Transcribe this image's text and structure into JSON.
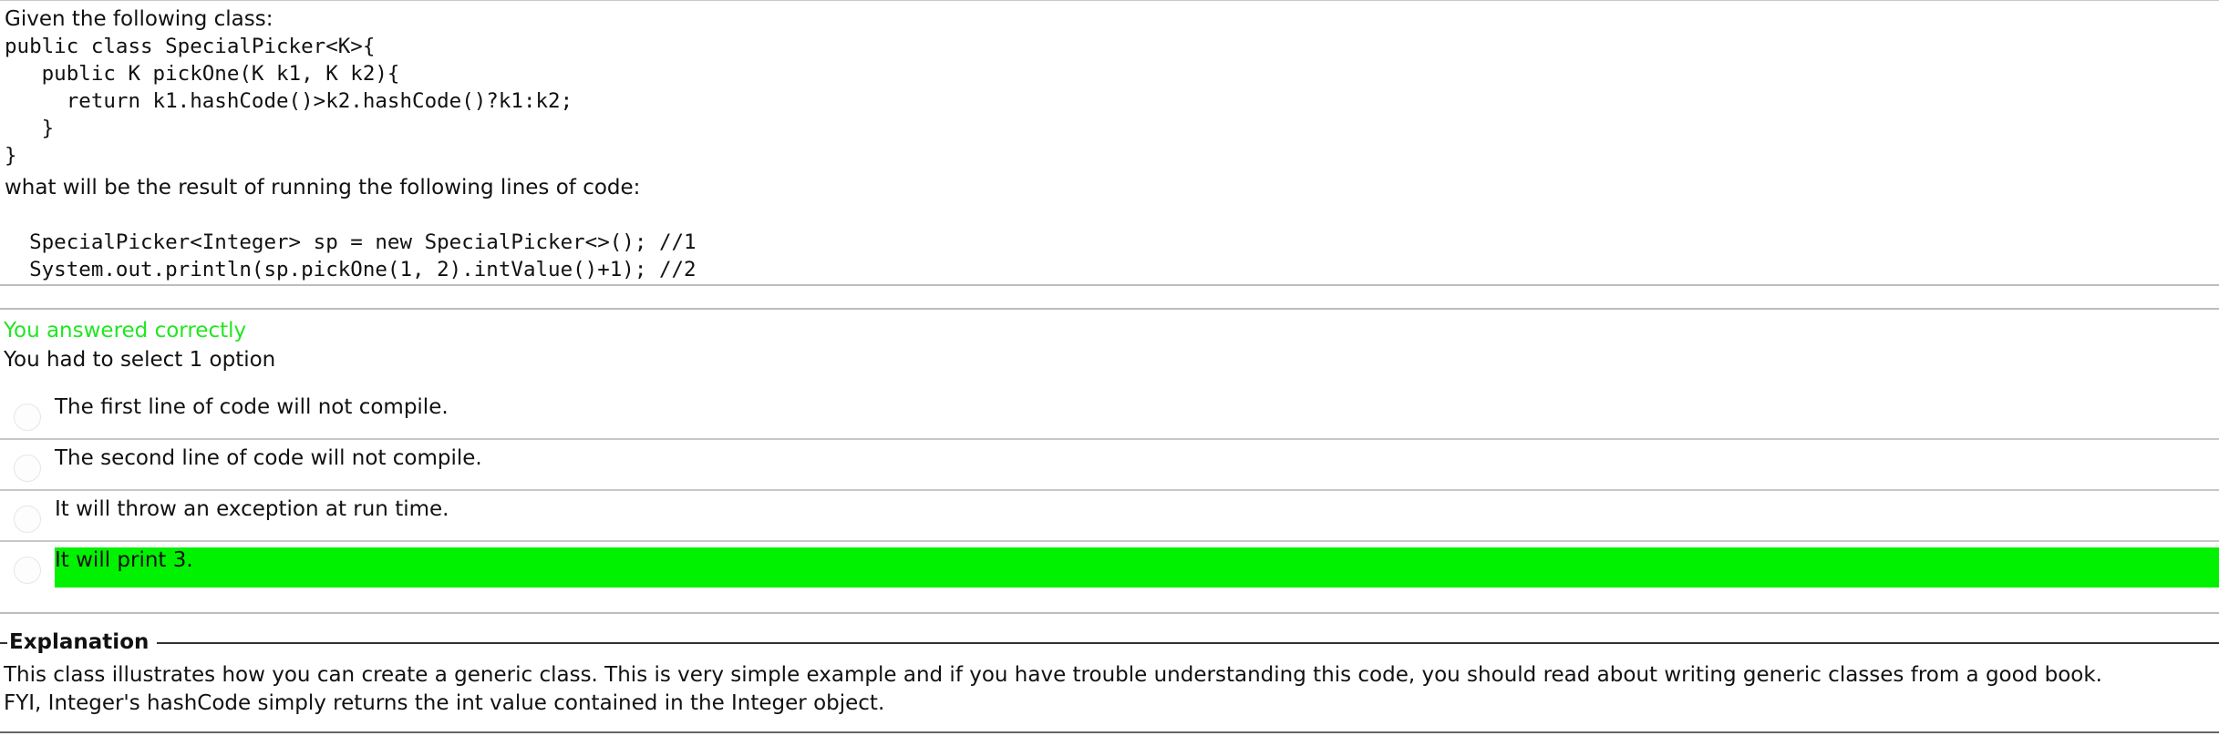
{
  "question": {
    "intro": "Given the following class:",
    "code_lines": [
      "public class SpecialPicker<K>{",
      "   public K pickOne(K k1, K k2){",
      "     return k1.hashCode()>k2.hashCode()?k1:k2;",
      "   }",
      "}"
    ],
    "prompt": "what will be the result of running the following lines of code:",
    "snippet_lines": [
      "  SpecialPicker<Integer> sp = new SpecialPicker<>(); //1",
      "  System.out.println(sp.pickOne(1, 2).intValue()+1); //2"
    ]
  },
  "result": {
    "status": "You answered correctly",
    "select_info": "You had to select 1 option",
    "options": [
      {
        "label": "The first line of code will not compile.",
        "selected": false
      },
      {
        "label": "The second line of code will not compile.",
        "selected": false
      },
      {
        "label": "It will throw an exception at run time.",
        "selected": false
      },
      {
        "label": "It will print 3.",
        "selected": true
      }
    ],
    "status_color": "#22e622",
    "highlight_color": "#00f200"
  },
  "explanation": {
    "title": "Explanation",
    "lines": [
      "This class illustrates how you can create a generic class. This is very simple example and if you have trouble understanding this code, you should read about writing generic classes from a good book.",
      "FYI, Integer's hashCode simply returns the int value contained in the Integer object."
    ]
  },
  "icons": {
    "radio": "radio-button-icon"
  }
}
